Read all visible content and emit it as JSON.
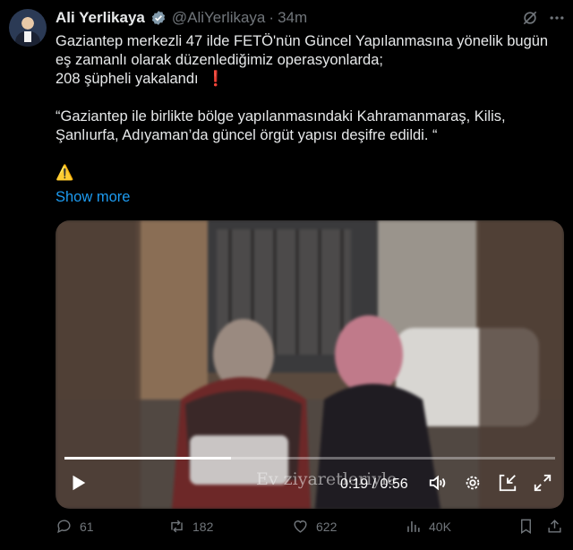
{
  "author": {
    "name": "Ali Yerlikaya",
    "handle": "@AliYerlikaya",
    "separator": "·",
    "time": "34m"
  },
  "tweet": {
    "line1": "Gaziantep merkezli 47 ilde FETÖ'nün Güncel Yapılanmasına yönelik bugün",
    "line2": "eş zamanlı olarak düzenlediğimiz operasyonlarda;",
    "line3": "208 şüpheli yakalandı",
    "line3_emoji": "❗",
    "quote1": "“Gaziantep ile birlikte bölge yapılanmasındaki Kahramanmaraş, Kilis,",
    "quote2": "Şanlıurfa, Adıyaman’da güncel örgüt yapısı deşifre edildi. “",
    "warning_emoji": "⚠️",
    "show_more": "Show more"
  },
  "video": {
    "caption": "Ev ziyaretleriyle",
    "current_time": "0:19",
    "divider": "/",
    "duration": "0:56",
    "progress": 0.339
  },
  "actions": {
    "replies": "61",
    "reposts": "182",
    "likes": "622",
    "views": "40K"
  },
  "colors": {
    "accent": "#1d9bf0",
    "muted": "#71767b",
    "alert": "#f4212e"
  },
  "icons": [
    "verified-badge-icon",
    "grok-icon",
    "more-icon",
    "play-icon",
    "volume-icon",
    "settings-icon",
    "minimize-icon",
    "fullscreen-icon",
    "reply-icon",
    "repost-icon",
    "like-icon",
    "views-icon",
    "bookmark-icon",
    "share-icon"
  ]
}
